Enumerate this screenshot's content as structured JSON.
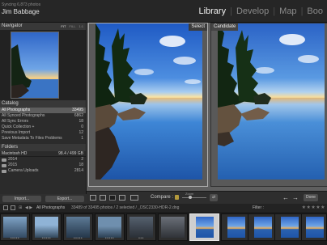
{
  "app": {
    "subtitle": "Syncing 6,873 photos",
    "user_name": "Jim Babbage"
  },
  "modules": [
    {
      "label": "Library",
      "active": true
    },
    {
      "label": "Develop",
      "active": false
    },
    {
      "label": "Map",
      "active": false
    },
    {
      "label": "Boo",
      "active": false
    }
  ],
  "navigator": {
    "title": "Navigator",
    "options": [
      "FIT",
      "FILL",
      "1:1"
    ]
  },
  "catalog": {
    "title": "Catalog",
    "items": [
      {
        "label": "All Photographs",
        "count": "33495",
        "selected": true
      },
      {
        "label": "All Synced Photographs",
        "count": "6862",
        "selected": false
      },
      {
        "label": "All Sync Errors",
        "count": "18",
        "selected": false
      },
      {
        "label": "Quick Collection +",
        "count": "0",
        "selected": false
      },
      {
        "label": "Previous Import",
        "count": "12",
        "selected": false
      },
      {
        "label": "Save Metadata To Files Problems",
        "count": "1",
        "selected": false
      }
    ]
  },
  "folders": {
    "title": "Folders",
    "volume": {
      "name": "Macintosh HD",
      "space": "98.4 / 499 GB"
    },
    "items": [
      {
        "label": "2014",
        "count": "2"
      },
      {
        "label": "2015",
        "count": "18"
      },
      {
        "label": "Camera Uploads",
        "count": "2814"
      }
    ]
  },
  "left_buttons": {
    "import": "Import...",
    "export": "Export..."
  },
  "compare": {
    "select_label": "Select",
    "candidate_label": "Candidate"
  },
  "toolbar": {
    "compare_label": "Compare :",
    "zoom_label": "Zoom",
    "left_arrow": "←",
    "right_arrow": "→",
    "done_label": "Done"
  },
  "filmstrip_bar": {
    "source": "All Photographs",
    "status": "33489 of 33495 photos / 2 selected / _DSC2330-HDR-2.dng",
    "filter_label": "Filter :",
    "stars": "★★★★★"
  },
  "colors": {
    "accent_selected": "#5d5d5d",
    "lock": "#b49a3c"
  }
}
